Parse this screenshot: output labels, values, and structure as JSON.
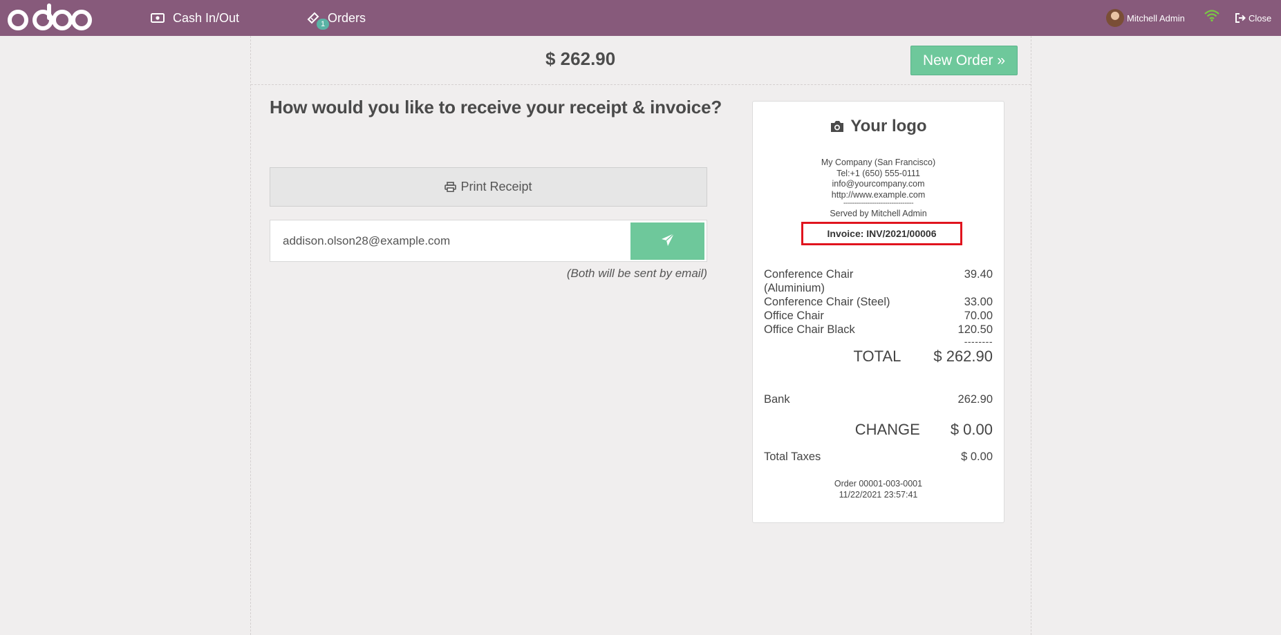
{
  "topbar": {
    "brand": "odoo",
    "cash_label": "Cash In/Out",
    "orders_label": "Orders",
    "orders_badge": "1",
    "user_name": "Mitchell Admin",
    "close_label": "Close",
    "colors": {
      "bar": "#875a7b",
      "wifi": "#7ac943"
    }
  },
  "main": {
    "amount_due": "$ 262.90",
    "new_order_label": "New Order »",
    "question": "How would you like to receive your receipt & invoice?",
    "print_receipt_label": "Print Receipt",
    "email_value": "addison.olson28@example.com",
    "email_note": "(Both will be sent by email)",
    "colors": {
      "primary": "#6ec89b"
    }
  },
  "receipt": {
    "logo_text": "Your logo",
    "company": "My Company (San Francisco)",
    "phone": "Tel:+1 (650) 555-0111",
    "email": "info@yourcompany.com",
    "website": "http://www.example.com",
    "dashes": "--------------------------------",
    "served_by": "Served by Mitchell Admin",
    "invoice": "Invoice: INV/2021/00006",
    "lines": [
      {
        "name": "Conference Chair (Aluminium)",
        "price": "39.40"
      },
      {
        "name": "Conference Chair (Steel)",
        "price": "33.00"
      },
      {
        "name": "Office Chair",
        "price": "70.00"
      },
      {
        "name": "Office Chair Black",
        "price": "120.50"
      }
    ],
    "separator": "--------",
    "total_label": "TOTAL",
    "total_value": "$ 262.90",
    "payment_method": "Bank",
    "payment_amount": "262.90",
    "change_label": "CHANGE",
    "change_value": "$ 0.00",
    "taxes_label": "Total Taxes",
    "taxes_value": "$ 0.00",
    "order_ref": "Order 00001-003-0001",
    "order_date": "11/22/2021 23:57:41",
    "highlight_color": "#e0141e"
  }
}
